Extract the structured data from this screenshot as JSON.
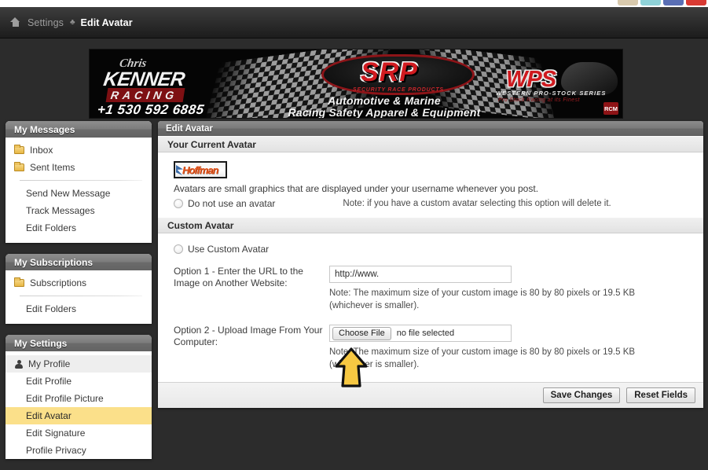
{
  "browser": {
    "tabs": [
      {
        "name": "tab-1",
        "color": "#d8c9ad"
      },
      {
        "name": "tab-2",
        "color": "#8fd2d8"
      },
      {
        "name": "tab-3",
        "color": "#5a6fb5"
      },
      {
        "name": "tab-4",
        "color": "#d93a33"
      }
    ]
  },
  "breadcrumb": {
    "home_icon": "home-icon",
    "parent": "Settings",
    "separator": "♣",
    "current": "Edit Avatar"
  },
  "banner": {
    "kenner_script": "Chris",
    "kenner_name": "KENNER",
    "kenner_racing": "RACING",
    "phone": "+1 530 592 6885",
    "srp_logo": "SRP",
    "srp_sub": "SECURITY RACE PRODUCTS",
    "tagline_1": "Automotive & Marine",
    "tagline_2": "Racing Safety Apparel & Equipment",
    "wps_logo": "WPS",
    "wps_sub": "WESTERN PRO-STOCK SERIES",
    "wps_sub2": "Pro Stock Racing at its Finest",
    "corner_badge": "RCM"
  },
  "sidebar": {
    "panels": [
      {
        "title": "My Messages",
        "items": [
          {
            "label": "Inbox",
            "icon": "folder-icon",
            "type": "folder"
          },
          {
            "label": "Sent Items",
            "icon": "folder-icon",
            "type": "folder"
          },
          {
            "divider": true
          },
          {
            "label": "Send New Message",
            "type": "link"
          },
          {
            "label": "Track Messages",
            "type": "link"
          },
          {
            "label": "Edit Folders",
            "type": "link"
          }
        ]
      },
      {
        "title": "My Subscriptions",
        "items": [
          {
            "label": "Subscriptions",
            "icon": "folder-icon",
            "type": "folder"
          },
          {
            "divider": true
          },
          {
            "label": "Edit Folders",
            "type": "link"
          }
        ]
      },
      {
        "title": "My Settings",
        "items": [
          {
            "label": "My Profile",
            "icon": "person-icon",
            "type": "profile"
          },
          {
            "label": "Edit Profile",
            "type": "link"
          },
          {
            "label": "Edit Profile Picture",
            "type": "link"
          },
          {
            "label": "Edit Avatar",
            "type": "link",
            "active": true
          },
          {
            "label": "Edit Signature",
            "type": "link"
          },
          {
            "label": "Profile Privacy",
            "type": "link"
          }
        ]
      }
    ]
  },
  "content": {
    "header": "Edit Avatar",
    "current_avatar": {
      "section_title": "Your Current Avatar",
      "avatar_alt": "Hoffman",
      "description": "Avatars are small graphics that are displayed under your username whenever you post.",
      "radio_label": "Do not use an avatar",
      "radio_note": "Note: if you have a custom avatar selecting this option will delete it."
    },
    "custom_avatar": {
      "section_title": "Custom Avatar",
      "radio_label": "Use Custom Avatar",
      "option1": {
        "label": "Option 1 - Enter the URL to the Image on Another Website:",
        "value": "http://www.",
        "note": "Note: The maximum size of your custom image is 80 by 80 pixels or 19.5 KB (whichever is smaller)."
      },
      "option2": {
        "label": "Option 2 - Upload Image From Your Computer:",
        "button": "Choose File",
        "file_status": "no file selected",
        "note": "Note: The maximum size of your custom image is 80 by 80 pixels or 19.5 KB (whichever is smaller)."
      }
    },
    "footer": {
      "save": "Save Changes",
      "reset": "Reset Fields"
    }
  },
  "annotation": {
    "arrow": "up-arrow-pointer",
    "color": "#f6c githubusercontent"
  },
  "colors": {
    "page_bg": "#2c2c2c",
    "accent_highlight": "#fbe08a",
    "panel_header": "#7a7a7a"
  }
}
